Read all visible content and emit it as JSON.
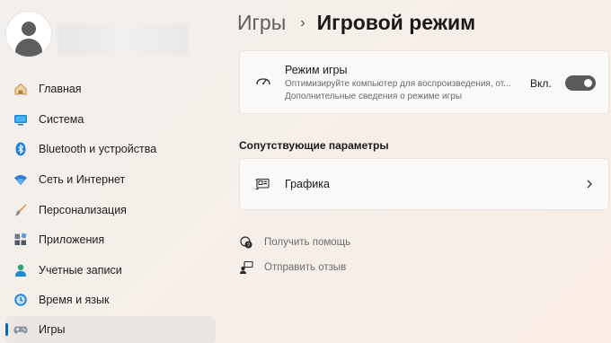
{
  "sidebar": {
    "items": [
      {
        "label": "Главная",
        "icon": "home-icon",
        "active": false
      },
      {
        "label": "Система",
        "icon": "system-icon",
        "active": false
      },
      {
        "label": "Bluetooth и устройства",
        "icon": "bluetooth-icon",
        "active": false
      },
      {
        "label": "Сеть и Интернет",
        "icon": "wifi-icon",
        "active": false
      },
      {
        "label": "Персонализация",
        "icon": "brush-icon",
        "active": false
      },
      {
        "label": "Приложения",
        "icon": "apps-icon",
        "active": false
      },
      {
        "label": "Учетные записи",
        "icon": "accounts-icon",
        "active": false
      },
      {
        "label": "Время и язык",
        "icon": "time-language-icon",
        "active": false
      },
      {
        "label": "Игры",
        "icon": "gaming-icon",
        "active": true
      }
    ]
  },
  "breadcrumb": {
    "parent": "Игры",
    "separator": "›",
    "current": "Игровой режим"
  },
  "game_mode": {
    "title": "Режим игры",
    "description": "Оптимизируйте компьютер для воспроизведения, от...",
    "more_info": "Дополнительные сведения о режиме игры",
    "toggle_label": "Вкл.",
    "enabled": true
  },
  "related": {
    "title": "Сопутствующие параметры",
    "graphics_label": "Графика"
  },
  "links": {
    "help": "Получить помощь",
    "feedback": "Отправить отзыв"
  },
  "colors": {
    "accent": "#0067c0",
    "toggle_on": "#5a5a5a"
  }
}
